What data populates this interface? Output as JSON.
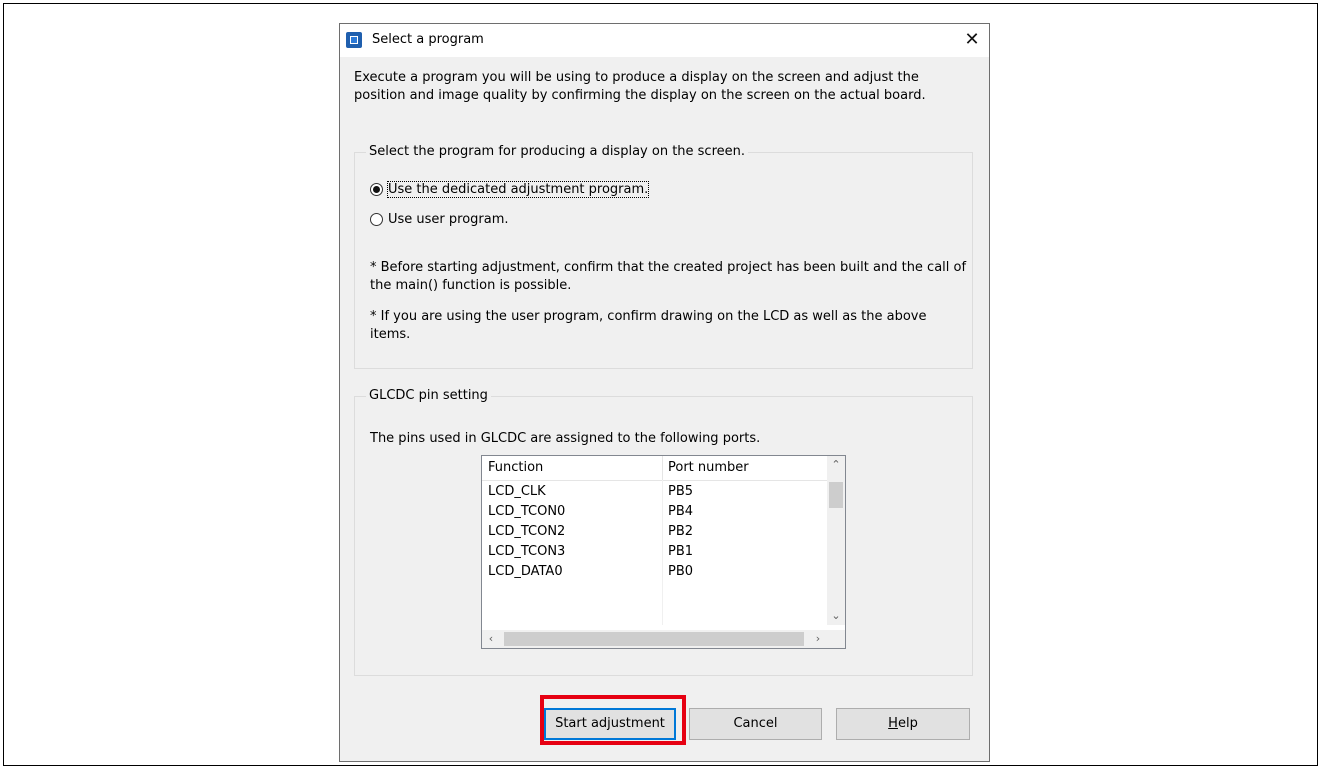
{
  "dialog": {
    "title": "Select a program",
    "intro": "Execute a program you will be using to produce a display on the screen and adjust the position and image quality by confirming the display on the screen on the actual board."
  },
  "program_group": {
    "legend": "Select the program for producing a display on the screen.",
    "options": [
      {
        "label": "Use the dedicated adjustment program.",
        "checked": true
      },
      {
        "label": "Use user program.",
        "checked": false
      }
    ],
    "note1": "* Before starting adjustment, confirm that the created project has been built and the call of the main() function is possible.",
    "note2": "* If you are using the user program, confirm drawing on the LCD as well as the above items."
  },
  "pin_group": {
    "legend": "GLCDC pin setting",
    "description": "The pins used in GLCDC are assigned to the following ports.",
    "columns": [
      "Function",
      "Port number"
    ],
    "rows": [
      [
        "LCD_CLK",
        "PB5"
      ],
      [
        "LCD_TCON0",
        "PB4"
      ],
      [
        "LCD_TCON2",
        "PB2"
      ],
      [
        "LCD_TCON3",
        "PB1"
      ],
      [
        "LCD_DATA0",
        "PB0"
      ]
    ]
  },
  "buttons": {
    "start": "Start adjustment",
    "cancel": "Cancel",
    "help_accel": "H",
    "help_rest": "elp"
  },
  "icons": {
    "app": "chip-icon",
    "close": "close-icon"
  },
  "colors": {
    "highlight": "#e60012",
    "default_button_border": "#0078d7"
  }
}
